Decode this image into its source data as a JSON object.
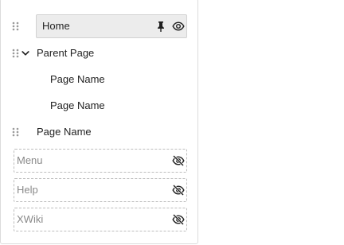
{
  "tree": {
    "home": {
      "label": "Home",
      "pin_icon": "pin-icon",
      "visibility_icon": "eye-icon"
    },
    "parent": {
      "label": "Parent Page",
      "expanded": true,
      "children": [
        {
          "label": "Page Name"
        },
        {
          "label": "Page Name"
        }
      ]
    },
    "sibling": {
      "label": "Page Name"
    },
    "hidden_items": [
      {
        "label": "Menu",
        "icon": "eye-off-icon"
      },
      {
        "label": "Help",
        "icon": "eye-off-icon"
      },
      {
        "label": "XWiki",
        "icon": "eye-off-icon"
      }
    ]
  },
  "colors": {
    "selected_background": "#ececec",
    "hidden_text": "#8a8a8a",
    "icon": "#1f1f1f"
  }
}
